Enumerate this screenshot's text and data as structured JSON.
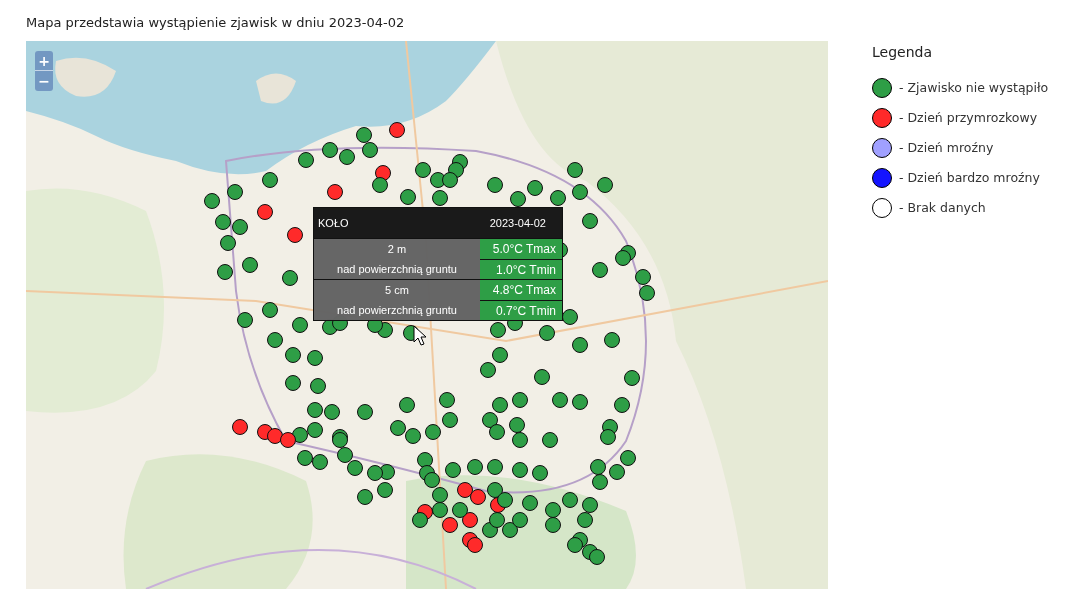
{
  "title": "Mapa przedstawia wystąpienie zjawisk w dniu 2023-04-02",
  "zoom_controls": [
    "+",
    "−"
  ],
  "legend": {
    "title": "Legenda",
    "items": [
      {
        "label": "- Zjawisko nie wystąpiło",
        "color": "#2e9e46"
      },
      {
        "label": "- Dzień przymrozkowy",
        "color": "#ff2a2a"
      },
      {
        "label": "- Dzień mroźny",
        "color": "#a0a0ff"
      },
      {
        "label": "- Dzień bardzo mroźny",
        "color": "#1414ff"
      },
      {
        "label": "- Brak danych",
        "color": "#ffffff"
      }
    ]
  },
  "tooltip": {
    "station": "KOŁO",
    "date": "2023-04-02",
    "levels": [
      {
        "height": "2 m",
        "description": "nad powierzchnią gruntu",
        "tmax": "5.0°C Tmax",
        "tmin": "1.0°C Tmin"
      },
      {
        "height": "5 cm",
        "description": "nad powierzchnią gruntu",
        "tmax": "4.8°C Tmax",
        "tmin": "0.7°C Tmin"
      }
    ]
  },
  "markers": [
    {
      "color": "#2e9e46"
    },
    {
      "color": "#ff2a2a"
    },
    {
      "color": "#2e9e46"
    },
    {
      "color": "#2e9e46"
    },
    {
      "color": "#2e9e46"
    },
    {
      "color": "#2e9e46"
    },
    {
      "color": "#ff2a2a"
    },
    {
      "color": "#2e9e46"
    },
    {
      "color": "#2e9e46"
    },
    {
      "color": "#2e9e46"
    },
    {
      "color": "#2e9e46"
    },
    {
      "color": "#2e9e46"
    },
    {
      "color": "#2e9e46"
    },
    {
      "color": "#2e9e46"
    },
    {
      "color": "#2e9e46"
    },
    {
      "color": "#2e9e46"
    },
    {
      "color": "#ff2a2a"
    },
    {
      "color": "#ff2a2a"
    },
    {
      "color": "#ff2a2a"
    },
    {
      "color": "#2e9e46"
    },
    {
      "color": "#2e9e46"
    },
    {
      "color": "#2e9e46"
    },
    {
      "color": "#2e9e46"
    },
    {
      "color": "#2e9e46"
    },
    {
      "color": "#2e9e46"
    },
    {
      "color": "#2e9e46"
    },
    {
      "color": "#2e9e46"
    },
    {
      "color": "#2e9e46"
    },
    {
      "color": "#2e9e46"
    },
    {
      "color": "#2e9e46"
    },
    {
      "color": "#2e9e46"
    },
    {
      "color": "#2e9e46"
    },
    {
      "color": "#2e9e46"
    },
    {
      "color": "#2e9e46"
    },
    {
      "color": "#2e9e46"
    },
    {
      "color": "#2e9e46"
    },
    {
      "color": "#2e9e46"
    },
    {
      "color": "#2e9e46"
    },
    {
      "color": "#2e9e46"
    },
    {
      "color": "#2e9e46"
    },
    {
      "color": "#2e9e46"
    },
    {
      "color": "#2e9e46"
    },
    {
      "color": "#2e9e46"
    },
    {
      "color": "#2e9e46"
    },
    {
      "color": "#2e9e46"
    },
    {
      "color": "#2e9e46"
    },
    {
      "color": "#2e9e46"
    },
    {
      "color": "#2e9e46"
    },
    {
      "color": "#2e9e46"
    },
    {
      "color": "#2e9e46"
    },
    {
      "color": "#2e9e46"
    },
    {
      "color": "#2e9e46"
    },
    {
      "color": "#2e9e46"
    },
    {
      "color": "#2e9e46"
    },
    {
      "color": "#2e9e46"
    },
    {
      "color": "#2e9e46"
    },
    {
      "color": "#2e9e46"
    },
    {
      "color": "#2e9e46"
    },
    {
      "color": "#2e9e46"
    },
    {
      "color": "#2e9e46"
    },
    {
      "color": "#2e9e46"
    },
    {
      "color": "#2e9e46"
    },
    {
      "color": "#2e9e46"
    },
    {
      "color": "#2e9e46"
    },
    {
      "color": "#2e9e46"
    },
    {
      "color": "#2e9e46"
    },
    {
      "color": "#2e9e46"
    },
    {
      "color": "#2e9e46"
    },
    {
      "color": "#2e9e46"
    },
    {
      "color": "#2e9e46"
    },
    {
      "color": "#2e9e46"
    },
    {
      "color": "#2e9e46"
    },
    {
      "color": "#2e9e46"
    },
    {
      "color": "#2e9e46"
    },
    {
      "color": "#2e9e46"
    },
    {
      "color": "#2e9e46"
    },
    {
      "color": "#2e9e46"
    },
    {
      "color": "#2e9e46"
    },
    {
      "color": "#2e9e46"
    },
    {
      "color": "#2e9e46"
    },
    {
      "color": "#2e9e46"
    },
    {
      "color": "#2e9e46"
    },
    {
      "color": "#2e9e46"
    },
    {
      "color": "#2e9e46"
    },
    {
      "color": "#ff2a2a"
    },
    {
      "color": "#ff2a2a"
    },
    {
      "color": "#ff2a2a"
    },
    {
      "color": "#ff2a2a"
    },
    {
      "color": "#2e9e46"
    },
    {
      "color": "#2e9e46"
    },
    {
      "color": "#2e9e46"
    },
    {
      "color": "#2e9e46"
    },
    {
      "color": "#2e9e46"
    },
    {
      "color": "#2e9e46"
    },
    {
      "color": "#2e9e46"
    },
    {
      "color": "#2e9e46"
    },
    {
      "color": "#2e9e46"
    },
    {
      "color": "#2e9e46"
    },
    {
      "color": "#2e9e46"
    },
    {
      "color": "#2e9e46"
    },
    {
      "color": "#2e9e46"
    },
    {
      "color": "#2e9e46"
    },
    {
      "color": "#2e9e46"
    },
    {
      "color": "#2e9e46"
    },
    {
      "color": "#2e9e46"
    },
    {
      "color": "#2e9e46"
    },
    {
      "color": "#2e9e46"
    },
    {
      "color": "#2e9e46"
    },
    {
      "color": "#2e9e46"
    },
    {
      "color": "#ff2a2a"
    },
    {
      "color": "#ff2a2a"
    },
    {
      "color": "#ff2a2a"
    },
    {
      "color": "#ff2a2a"
    },
    {
      "color": "#ff2a2a"
    },
    {
      "color": "#2e9e46"
    },
    {
      "color": "#ff2a2a"
    },
    {
      "color": "#ff2a2a"
    },
    {
      "color": "#ff2a2a"
    },
    {
      "color": "#2e9e46"
    },
    {
      "color": "#2e9e46"
    },
    {
      "color": "#2e9e46"
    },
    {
      "color": "#2e9e46"
    },
    {
      "color": "#2e9e46"
    },
    {
      "color": "#2e9e46"
    },
    {
      "color": "#2e9e46"
    },
    {
      "color": "#2e9e46"
    },
    {
      "color": "#2e9e46"
    },
    {
      "color": "#2e9e46"
    },
    {
      "color": "#2e9e46"
    },
    {
      "color": "#2e9e46"
    },
    {
      "color": "#2e9e46"
    },
    {
      "color": "#2e9e46"
    },
    {
      "color": "#2e9e46"
    },
    {
      "color": "#2e9e46"
    },
    {
      "color": "#2e9e46"
    },
    {
      "color": "#2e9e46"
    },
    {
      "color": "#2e9e46"
    },
    {
      "color": "#2e9e46"
    },
    {
      "color": "#2e9e46"
    },
    {
      "color": "#2e9e46"
    },
    {
      "color": "#2e9e46"
    }
  ]
}
